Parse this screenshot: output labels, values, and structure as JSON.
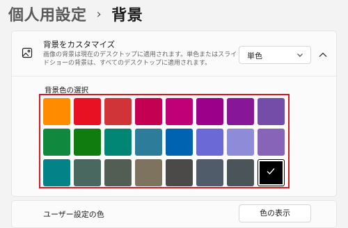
{
  "breadcrumb": {
    "parent": "個人用設定",
    "separator": "›",
    "current": "背景"
  },
  "background_setting": {
    "title": "背景をカスタマイズ",
    "description": "画像の背景は現在のデスクトップに適用されます。単色またはスライドショーの背景は、すべてのデスクトップに適用されます。",
    "dropdown_value": "単色",
    "icon": "picture-icon"
  },
  "color_picker": {
    "label": "背景色の選択",
    "highlight_border_color": "#d8191f",
    "selected_index": 23,
    "swatches": [
      "#ff8c00",
      "#e81123",
      "#d13438",
      "#c30052",
      "#bf0077",
      "#9a0089",
      "#881798",
      "#744da9",
      "#10893e",
      "#107c10",
      "#018574",
      "#2d7d9a",
      "#0063b1",
      "#6b69d6",
      "#8e8cd8",
      "#8764b8",
      "#038387",
      "#486860",
      "#525e54",
      "#7e735f",
      "#4c4a48",
      "#515c6b",
      "#4a5459",
      "#000000"
    ]
  },
  "user_color": {
    "label": "ユーザー設定の色",
    "button_label": "色の表示"
  }
}
